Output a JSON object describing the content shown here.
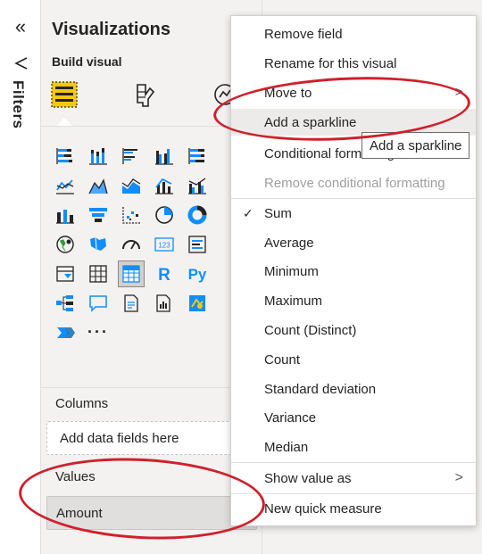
{
  "filters_pane": {
    "collapse_icon": "double-chevron-left-icon",
    "filter_icon": "funnel-icon",
    "label": "Filters"
  },
  "visualizations": {
    "title": "Visualizations",
    "build_visual_label": "Build visual",
    "mode_tabs": [
      "build-visual-icon",
      "format-visual-icon",
      "analytics-icon"
    ],
    "gallery_rows": [
      [
        "stacked-bar-chart-icon",
        "stacked-column-chart-icon",
        "clustered-bar-chart-icon",
        "clustered-column-chart-icon",
        "100-stacked-bar-chart-icon"
      ],
      [
        "line-chart-icon",
        "area-chart-icon",
        "stacked-area-chart-icon",
        "line-and-stacked-column-icon",
        "line-and-clustered-column-icon"
      ],
      [
        "ribbon-chart-icon",
        "funnel-icon",
        "scatter-chart-icon",
        "pie-chart-icon",
        "donut-chart-icon"
      ],
      [
        "map-icon",
        "filled-map-icon",
        "gauge-icon",
        "card-icon",
        "multi-row-card-icon"
      ],
      [
        "slicer-icon",
        "table-icon",
        "matrix-icon",
        "r-script-icon",
        "python-visual-icon"
      ],
      [
        "decomposition-tree-icon",
        "qa-icon",
        "smart-narrative-icon",
        "paginated-report-icon",
        "arcgis-map-icon"
      ],
      [
        "power-automate-icon",
        "more-visuals-icon"
      ]
    ],
    "more_label": "···",
    "r_label": "R",
    "py_label": "Py",
    "card_label": "123",
    "columns_label": "Columns",
    "columns_placeholder": "Add data fields here",
    "values_label": "Values",
    "values_field": "Amount"
  },
  "context_menu": {
    "items": [
      {
        "label": "Remove field"
      },
      {
        "label": "Rename for this visual"
      },
      {
        "label": "Move to",
        "submenu": true
      },
      {
        "label": "Add a sparkline",
        "highlighted": true
      },
      {
        "label": "Conditional formatting"
      },
      {
        "label": "Remove conditional formatting",
        "disabled": true
      },
      {
        "label": "Sum",
        "checked": true
      },
      {
        "label": "Average"
      },
      {
        "label": "Minimum"
      },
      {
        "label": "Maximum"
      },
      {
        "label": "Count (Distinct)"
      },
      {
        "label": "Count"
      },
      {
        "label": "Standard deviation"
      },
      {
        "label": "Variance"
      },
      {
        "label": "Median"
      },
      {
        "label": "Show value as",
        "submenu": true
      },
      {
        "label": "New quick measure"
      }
    ]
  },
  "tooltip": "Add a sparkline",
  "colors": {
    "pane_bg": "#f3f2f1",
    "accent_yellow": "#f2c811",
    "chart_blue": "#118dff",
    "annotation_red": "#d0202a"
  }
}
